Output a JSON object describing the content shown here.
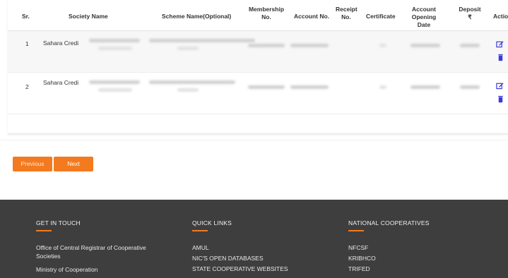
{
  "table": {
    "headers": {
      "sr": "Sr.",
      "society_name": "Society Name",
      "scheme_name": "Scheme Name(Optional)",
      "membership_no": [
        "Membership",
        "No."
      ],
      "account_no": "Account No.",
      "receipt_no": [
        "Receipt",
        "No."
      ],
      "certificate": "Certificate",
      "account_opening_date": [
        "Account Opening",
        "Date"
      ],
      "deposit": [
        "Deposit",
        "₹"
      ],
      "action": "Action"
    },
    "rows": [
      {
        "sr": "1",
        "society_name": "Sahara Credit"
      },
      {
        "sr": "2",
        "society_name": "Sahara Credit"
      }
    ]
  },
  "pagination": {
    "previous_label": "Previous",
    "next_label": "Next"
  },
  "footer": {
    "get_in_touch": {
      "heading": "GET IN TOUCH",
      "lines": [
        "Office of Central Registrar of Cooperative",
        "Societies",
        "Ministry of Cooperation"
      ]
    },
    "quick_links": {
      "heading": "QUICK LINKS",
      "links": [
        "AMUL",
        "NIC'S OPEN DATABASES",
        "STATE COOPERATIVE WEBSITES"
      ]
    },
    "national_cooperatives": {
      "heading": "NATIONAL COOPERATIVES",
      "links": [
        "NFCSF",
        "KRIBHCO",
        "TRIFED"
      ]
    }
  },
  "colors": {
    "accent": "#f47a1f",
    "footer_bg": "#3e3e3e",
    "action_icon": "#3a3ad6"
  }
}
